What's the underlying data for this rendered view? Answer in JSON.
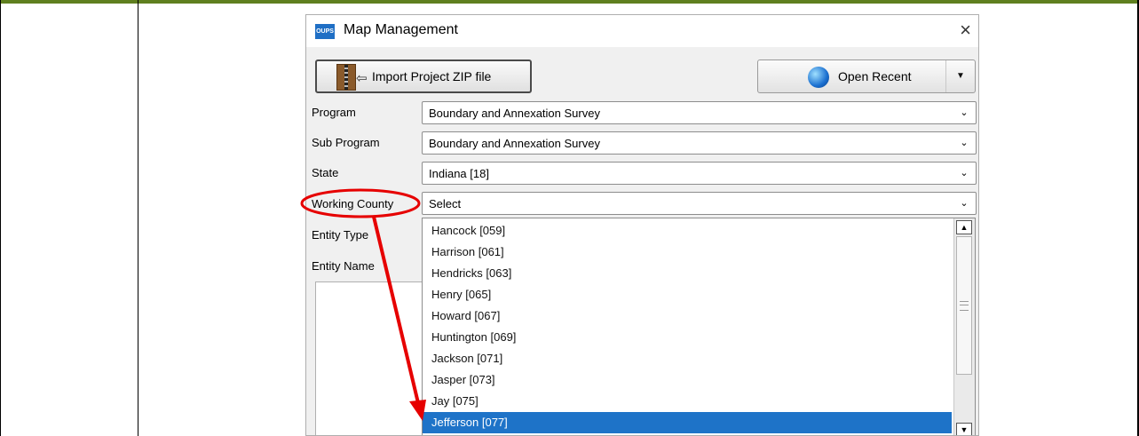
{
  "window": {
    "title": "Map Management",
    "app_icon_text": "OUPS",
    "close_glyph": "×"
  },
  "toolbar": {
    "import_label": "Import Project ZIP file",
    "import_arrow": "⇦",
    "recent_label": "Open Recent",
    "recent_caret": "▼"
  },
  "form": {
    "program": {
      "label": "Program",
      "value": "Boundary and Annexation Survey"
    },
    "sub_program": {
      "label": "Sub Program",
      "value": "Boundary and Annexation Survey"
    },
    "state": {
      "label": "State",
      "value": "Indiana [18]"
    },
    "working_county": {
      "label": "Working County",
      "value": "Select"
    },
    "entity_type": {
      "label": "Entity Type"
    },
    "entity_name": {
      "label": "Entity Name"
    },
    "dropdown_arrow": "⌄"
  },
  "county_options": [
    "Hancock [059]",
    "Harrison [061]",
    "Hendricks [063]",
    "Henry [065]",
    "Howard [067]",
    "Huntington [069]",
    "Jackson [071]",
    "Jasper [073]",
    "Jay [075]",
    "Jefferson [077]"
  ],
  "selected_option": "Jefferson [077]",
  "scrollbar": {
    "up": "▲",
    "down": "▼"
  },
  "colors": {
    "selection": "#1e73c8",
    "annotation": "#e60000",
    "frame_accent": "#5f7f1f"
  }
}
